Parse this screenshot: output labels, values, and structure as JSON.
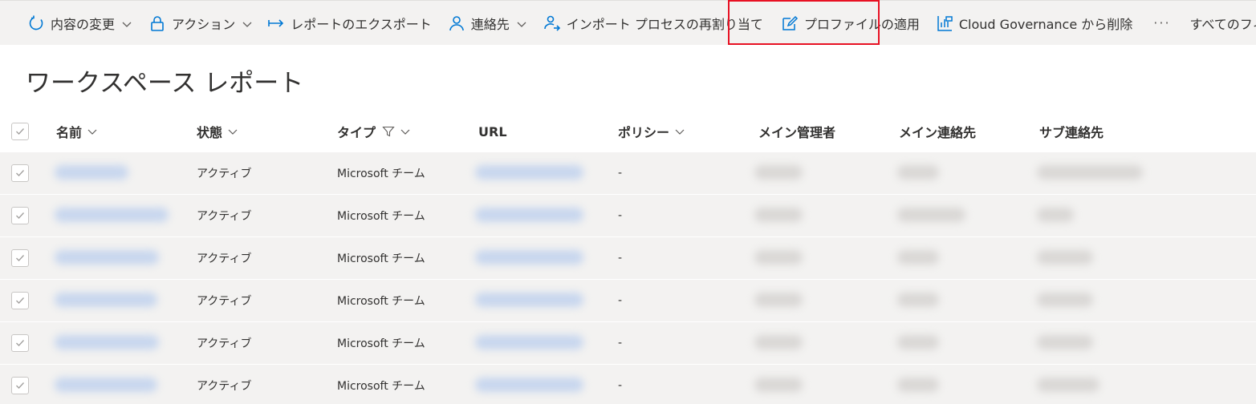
{
  "toolbar": {
    "items": [
      {
        "label": "内容の変更",
        "icon": "refresh-icon",
        "has_dropdown": true
      },
      {
        "label": "アクション",
        "icon": "lock-icon",
        "has_dropdown": true
      },
      {
        "label": "レポートのエクスポート",
        "icon": "export-arrow-icon",
        "has_dropdown": false
      },
      {
        "label": "連絡先",
        "icon": "person-icon",
        "has_dropdown": true
      },
      {
        "label": "インポート プロセスの再割り当て",
        "icon": "person-reassign-icon",
        "has_dropdown": false
      },
      {
        "label": "プロファイルの適用",
        "icon": "edit-profile-icon",
        "has_dropdown": false
      },
      {
        "label": "Cloud Governance から削除",
        "icon": "remove-chart-icon",
        "has_dropdown": false
      },
      {
        "label": "···",
        "icon": "more-icon",
        "has_dropdown": false
      },
      {
        "label": "すべてのフィルター済み",
        "icon": "",
        "has_dropdown": false
      }
    ],
    "highlight_color": "#e81123"
  },
  "page": {
    "title": "ワークスペース レポート"
  },
  "table": {
    "columns": [
      {
        "label": "名前",
        "sortable": true
      },
      {
        "label": "状態",
        "sortable": true
      },
      {
        "label": "タイプ",
        "sortable": true,
        "filter": true
      },
      {
        "label": "URL",
        "sortable": false
      },
      {
        "label": "ポリシー",
        "sortable": true
      },
      {
        "label": "メイン管理者",
        "sortable": false
      },
      {
        "label": "メイン連絡先",
        "sortable": false
      },
      {
        "label": "サブ連絡先",
        "sortable": false
      }
    ],
    "rows": [
      {
        "status": "アクティブ",
        "type": "Microsoft チーム",
        "policy": "-"
      },
      {
        "status": "アクティブ",
        "type": "Microsoft チーム",
        "policy": "-"
      },
      {
        "status": "アクティブ",
        "type": "Microsoft チーム",
        "policy": "-"
      },
      {
        "status": "アクティブ",
        "type": "Microsoft チーム",
        "policy": "-"
      },
      {
        "status": "アクティブ",
        "type": "Microsoft チーム",
        "policy": "-"
      },
      {
        "status": "アクティブ",
        "type": "Microsoft チーム",
        "policy": "-"
      }
    ]
  },
  "colors": {
    "accent": "#0078d4",
    "row_bg": "#f3f2f1",
    "toolbar_bg": "#f3f2f1"
  }
}
